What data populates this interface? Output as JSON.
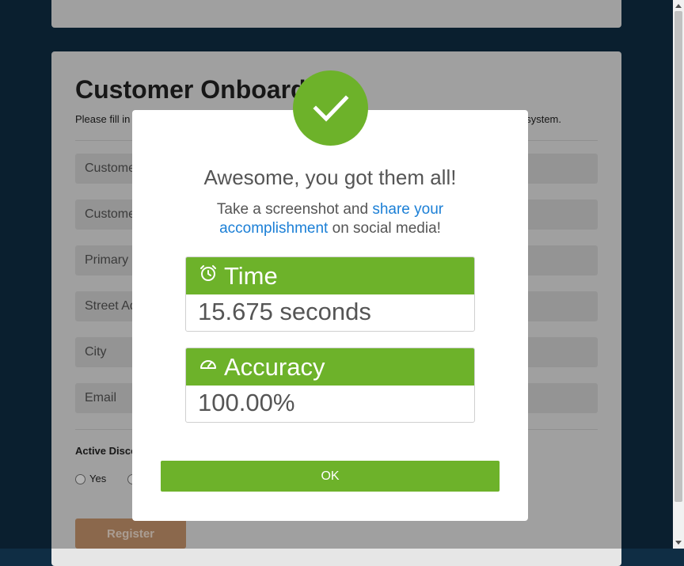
{
  "form": {
    "title": "Customer Onboard",
    "description_start": "Please fill in",
    "description_end": "system.",
    "fields": [
      {
        "placeholder": "Custome"
      },
      {
        "placeholder": "Custome"
      },
      {
        "placeholder": "Primary"
      },
      {
        "placeholder": "Street Ad"
      },
      {
        "placeholder": "City"
      },
      {
        "placeholder": "Email"
      }
    ],
    "discount_label": "Active Disco",
    "radio_yes": "Yes",
    "register_label": "Register"
  },
  "modal": {
    "title": "Awesome, you got them all!",
    "text_before": "Take a screenshot and ",
    "link_text": "share your accomplishment",
    "text_after": " on social media!",
    "time": {
      "label": "Time",
      "value": "15.675 seconds",
      "icon": "alarm-clock-icon"
    },
    "accuracy": {
      "label": "Accuracy",
      "value": "100.00%",
      "icon": "speedometer-icon"
    },
    "ok_label": "OK",
    "success_icon": "checkmark-icon"
  },
  "colors": {
    "background": "#0f2d44",
    "success_green": "#6db22a",
    "link_blue": "#1b7fd6",
    "register_button": "#c7966e"
  }
}
